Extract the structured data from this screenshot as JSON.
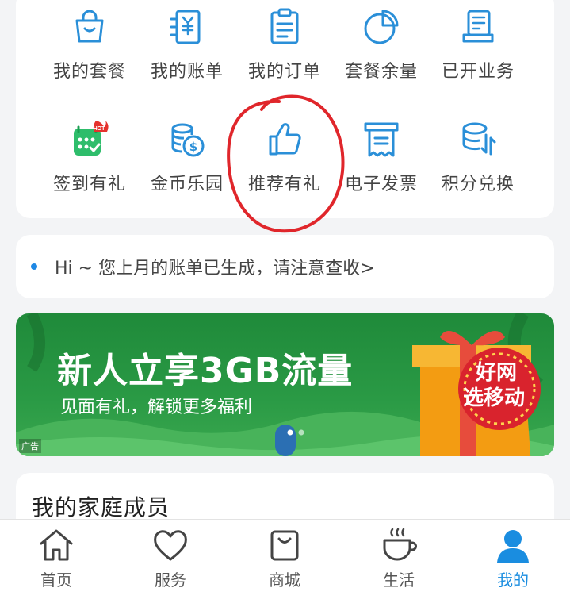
{
  "grid": {
    "row1": [
      {
        "label": "我的套餐",
        "icon": "shopping-bag-icon"
      },
      {
        "label": "我的账单",
        "icon": "bill-icon"
      },
      {
        "label": "我的订单",
        "icon": "clipboard-icon"
      },
      {
        "label": "套餐余量",
        "icon": "pie-chart-icon"
      },
      {
        "label": "已开业务",
        "icon": "document-stack-icon"
      }
    ],
    "row2": [
      {
        "label": "签到有礼",
        "icon": "calendar-hot-icon",
        "badge": "HOT"
      },
      {
        "label": "金币乐园",
        "icon": "coins-icon"
      },
      {
        "label": "推荐有礼",
        "icon": "thumbs-up-icon"
      },
      {
        "label": "电子发票",
        "icon": "invoice-icon"
      },
      {
        "label": "积分兑换",
        "icon": "points-exchange-icon"
      }
    ]
  },
  "notice": {
    "text": "Hi ~ 您上月的账单已生成，请注意查收>"
  },
  "banner": {
    "title": "新人立享3GB流量",
    "subtitle": "见面有礼，解锁更多福利",
    "ad_tag": "广告",
    "gift_line1": "好网",
    "gift_line2": "选移动"
  },
  "family": {
    "title": "我的家庭成员"
  },
  "tabs": [
    {
      "label": "首页",
      "icon": "home-icon"
    },
    {
      "label": "服务",
      "icon": "heart-icon"
    },
    {
      "label": "商城",
      "icon": "bag-icon"
    },
    {
      "label": "生活",
      "icon": "coffee-cup-icon"
    },
    {
      "label": "我的",
      "icon": "user-icon",
      "active": true
    }
  ],
  "colors": {
    "accent": "#1a8de0",
    "icon_blue": "#2a8fd8",
    "green": "#2a9a45",
    "annotation_red": "#e0262b"
  }
}
